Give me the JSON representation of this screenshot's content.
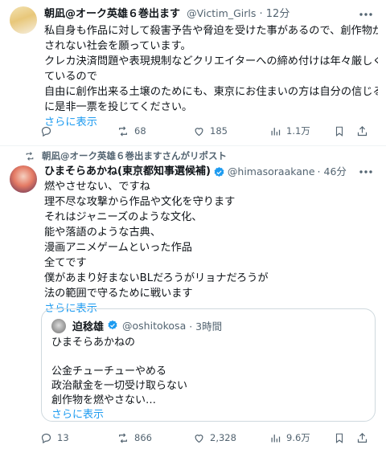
{
  "post1": {
    "display_name": "朝凪@オーク英雄６巻出ます",
    "handle": "@Victim_Girls",
    "time": "· 12分",
    "lines": [
      "私自身も作品に対して殺害予告や脅迫を受けた事があるので、創作物が燃や",
      "されない社会を願っています。",
      "クレカ決済問題や表現規制などクリエイターへの締め付けは年々厳しくなっ",
      "ているので",
      "自由に創作出来る土壌のためにも、東京にお住まいの方は自分の信じる候補",
      "に是非一票を投じてください。"
    ],
    "show_more": "さらに表示",
    "actions": {
      "replies": "",
      "reposts": "68",
      "likes": "185",
      "views": "1.1万"
    }
  },
  "repost_label": "朝凪@オーク英雄６巻出ますさんがリポスト",
  "post2": {
    "display_name": "ひまそらあかね(東京都知事選候補)",
    "handle": "@himasoraakane",
    "time": "· 46分",
    "lines": [
      "燃やさせない、ですね",
      "理不尽な攻撃から作品や文化を守ります",
      "それはジャニーズのような文化、",
      "能や落語のような古典、",
      "漫画アニメゲームといった作品",
      "全てです",
      "僕があまり好まないBLだろうがリョナだろうが",
      "法の範囲で守るために戦います"
    ],
    "show_more": "さらに表示",
    "quote": {
      "display_name": "迫稔雄",
      "handle": "@oshitokosa",
      "time": "· 3時間",
      "lines": [
        "ひまそらあかねの",
        "",
        "公金チューチューやめる",
        "政治献金を一切受け取らない",
        "創作物を燃やさない…"
      ],
      "show_more": "さらに表示"
    },
    "actions": {
      "replies": "13",
      "reposts": "866",
      "likes": "2,328",
      "views": "9.6万"
    }
  },
  "colors": {
    "accent": "#1d9bf0",
    "muted": "#536471",
    "border": "#cfd9de"
  }
}
